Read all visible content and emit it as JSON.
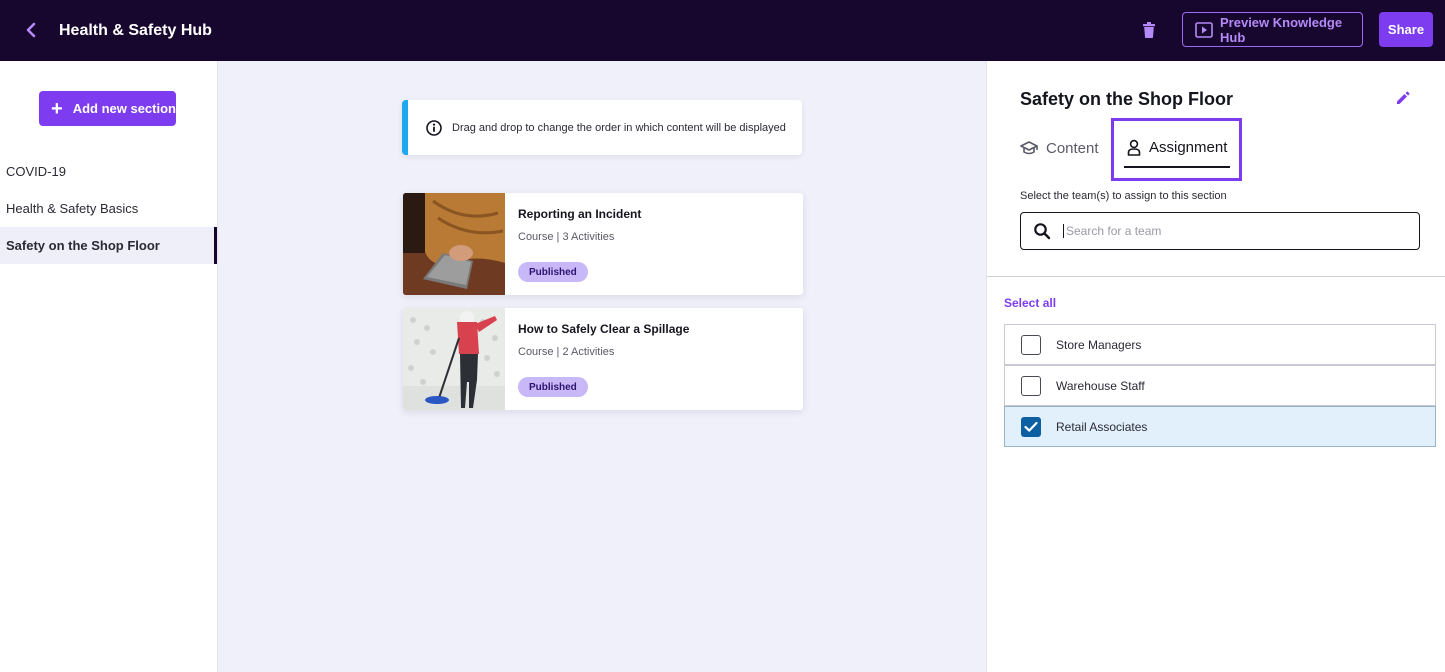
{
  "header": {
    "title": "Health & Safety Hub",
    "preview_label": "Preview Knowledge Hub",
    "share_label": "Share",
    "icons": {
      "back": "chevron-left-icon",
      "delete": "trash-icon",
      "preview": "play-icon"
    }
  },
  "sidebar": {
    "add_label": "Add new section",
    "items": [
      {
        "label": "COVID-19",
        "active": false
      },
      {
        "label": "Health & Safety Basics",
        "active": false
      },
      {
        "label": "Safety on the Shop Floor",
        "active": true
      }
    ]
  },
  "main": {
    "hint": "Drag and drop to change the order in which content will be displayed",
    "courses": [
      {
        "title": "Reporting an Incident",
        "type": "Course",
        "activities": "3 Activities",
        "status": "Published"
      },
      {
        "title": "How to Safely Clear a Spillage",
        "type": "Course",
        "activities": "2 Activities",
        "status": "Published"
      }
    ]
  },
  "panel": {
    "title": "Safety on the Shop Floor",
    "tabs": [
      {
        "label": "Content",
        "icon": "graduation-cap-icon",
        "active": false
      },
      {
        "label": "Assignment",
        "icon": "person-icon",
        "active": true
      }
    ],
    "assign_hint": "Select the team(s) to assign to this section",
    "search_placeholder": "Search for a team",
    "search_value": "",
    "select_all_label": "Select all",
    "teams": [
      {
        "name": "Store Managers",
        "checked": false
      },
      {
        "name": "Warehouse Staff",
        "checked": false
      },
      {
        "name": "Retail Associates",
        "checked": true
      }
    ]
  },
  "colors": {
    "topbar": "#17062e",
    "accent": "#7d3cf0",
    "info_border": "#1fa8f0",
    "badge_bg": "#c8b8f8",
    "checkbox_checked": "#0c5fa0",
    "checked_row_bg": "#e2f0fb"
  }
}
